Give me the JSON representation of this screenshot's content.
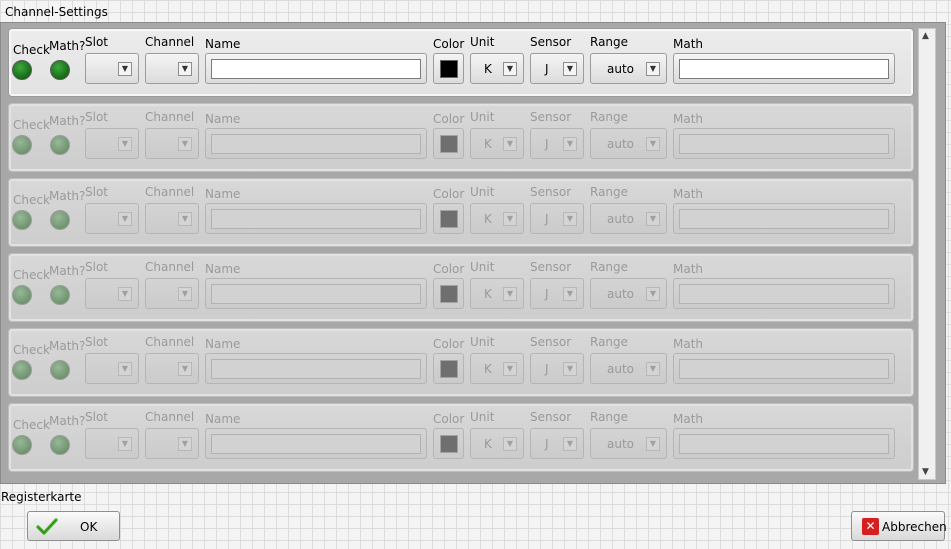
{
  "window_title": "Channel-Settings",
  "columns": {
    "check": "Check",
    "math_flag": "Math?",
    "slot": "Slot",
    "channel": "Channel",
    "name": "Name",
    "color": "Color",
    "unit": "Unit",
    "sensor": "Sensor",
    "range": "Range",
    "math": "Math"
  },
  "rows": [
    {
      "state": "active",
      "slot": "",
      "channel": "",
      "name": "",
      "color": "#000000",
      "unit": "K",
      "sensor": "J",
      "range": "auto",
      "math": ""
    },
    {
      "state": "disabled",
      "slot": "",
      "channel": "",
      "name": "",
      "color": "#6f6f6f",
      "unit": "K",
      "sensor": "J",
      "range": "auto",
      "math": ""
    },
    {
      "state": "disabled",
      "slot": "",
      "channel": "",
      "name": "",
      "color": "#6f6f6f",
      "unit": "K",
      "sensor": "J",
      "range": "auto",
      "math": ""
    },
    {
      "state": "disabled",
      "slot": "",
      "channel": "",
      "name": "",
      "color": "#6f6f6f",
      "unit": "K",
      "sensor": "J",
      "range": "auto",
      "math": ""
    },
    {
      "state": "disabled",
      "slot": "",
      "channel": "",
      "name": "",
      "color": "#6f6f6f",
      "unit": "K",
      "sensor": "J",
      "range": "auto",
      "math": ""
    },
    {
      "state": "disabled",
      "slot": "",
      "channel": "",
      "name": "",
      "color": "#6f6f6f",
      "unit": "K",
      "sensor": "J",
      "range": "auto",
      "math": ""
    }
  ],
  "tab_label": "Registerkarte",
  "buttons": {
    "ok": "OK",
    "cancel": "Abbrechen"
  },
  "icons": {
    "led": "led-indicator-icon",
    "dropdown": "dropdown-arrow-icon",
    "ok": "checkmark-icon",
    "cancel": "close-icon"
  },
  "colors": {
    "led_on": "#1f8a1f",
    "led_off": "#7da37d",
    "cancel_icon": "#d42020",
    "ok_icon": "#4fb830"
  }
}
